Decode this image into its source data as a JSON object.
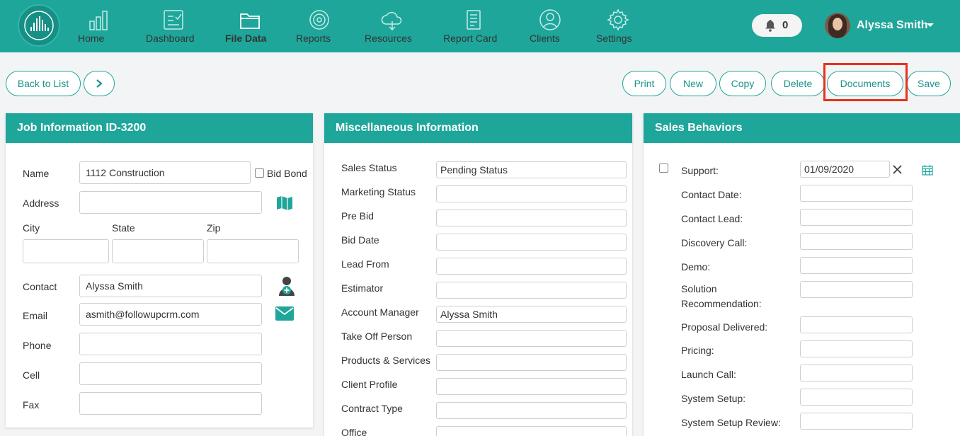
{
  "nav": {
    "items": [
      {
        "label": "Home",
        "icon": "bar-chart-icon"
      },
      {
        "label": "Dashboard",
        "icon": "dashboard-icon"
      },
      {
        "label": "File Data",
        "icon": "folder-icon"
      },
      {
        "label": "Reports",
        "icon": "target-icon"
      },
      {
        "label": "Resources",
        "icon": "cloud-icon"
      },
      {
        "label": "Report Card",
        "icon": "report-card-icon"
      },
      {
        "label": "Clients",
        "icon": "user-icon"
      },
      {
        "label": "Settings",
        "icon": "gear-icon"
      }
    ],
    "active": "File Data",
    "notifications": "0",
    "user_name": "Alyssa Smith"
  },
  "toolbar": {
    "back_label": "Back to List",
    "print_label": "Print",
    "new_label": "New",
    "copy_label": "Copy",
    "delete_label": "Delete",
    "documents_label": "Documents",
    "save_label": "Save"
  },
  "job": {
    "title": "Job Information ID-3200",
    "name_label": "Name",
    "name_value": "1112 Construction",
    "bid_bond_label": "Bid Bond",
    "address_label": "Address",
    "address_value": "",
    "city_label": "City",
    "state_label": "State",
    "zip_label": "Zip",
    "contact_label": "Contact",
    "contact_value": "Alyssa Smith",
    "email_label": "Email",
    "email_value": "asmith@followupcrm.com",
    "phone_label": "Phone",
    "cell_label": "Cell",
    "fax_label": "Fax"
  },
  "misc": {
    "title": "Miscellaneous Information",
    "fields": [
      {
        "label": "Sales Status",
        "value": "Pending Status"
      },
      {
        "label": "Marketing Status",
        "value": ""
      },
      {
        "label": "Pre Bid",
        "value": ""
      },
      {
        "label": "Bid Date",
        "value": ""
      },
      {
        "label": "Lead From",
        "value": ""
      },
      {
        "label": "Estimator",
        "value": ""
      },
      {
        "label": "Account Manager",
        "value": "Alyssa Smith"
      },
      {
        "label": "Take Off Person",
        "value": ""
      },
      {
        "label": "Products & Services",
        "value": ""
      },
      {
        "label": "Client Profile",
        "value": ""
      },
      {
        "label": "Contract Type",
        "value": ""
      },
      {
        "label": "Office",
        "value": ""
      }
    ]
  },
  "sales": {
    "title": "Sales Behaviors",
    "support_label": "Support:",
    "support_date": "01/09/2020",
    "fields": [
      {
        "label": "Contact Date:"
      },
      {
        "label": "Contact Lead:"
      },
      {
        "label": "Discovery Call:"
      },
      {
        "label": "Demo:"
      },
      {
        "label": "Solution"
      },
      {
        "label": "Recommendation:"
      },
      {
        "label": "Proposal Delivered:"
      },
      {
        "label": "Pricing:"
      },
      {
        "label": "Launch Call:"
      },
      {
        "label": "System Setup:"
      },
      {
        "label": "System Setup Review:"
      }
    ]
  },
  "colors": {
    "accent": "#1fa69b",
    "highlight": "#e8321c"
  }
}
